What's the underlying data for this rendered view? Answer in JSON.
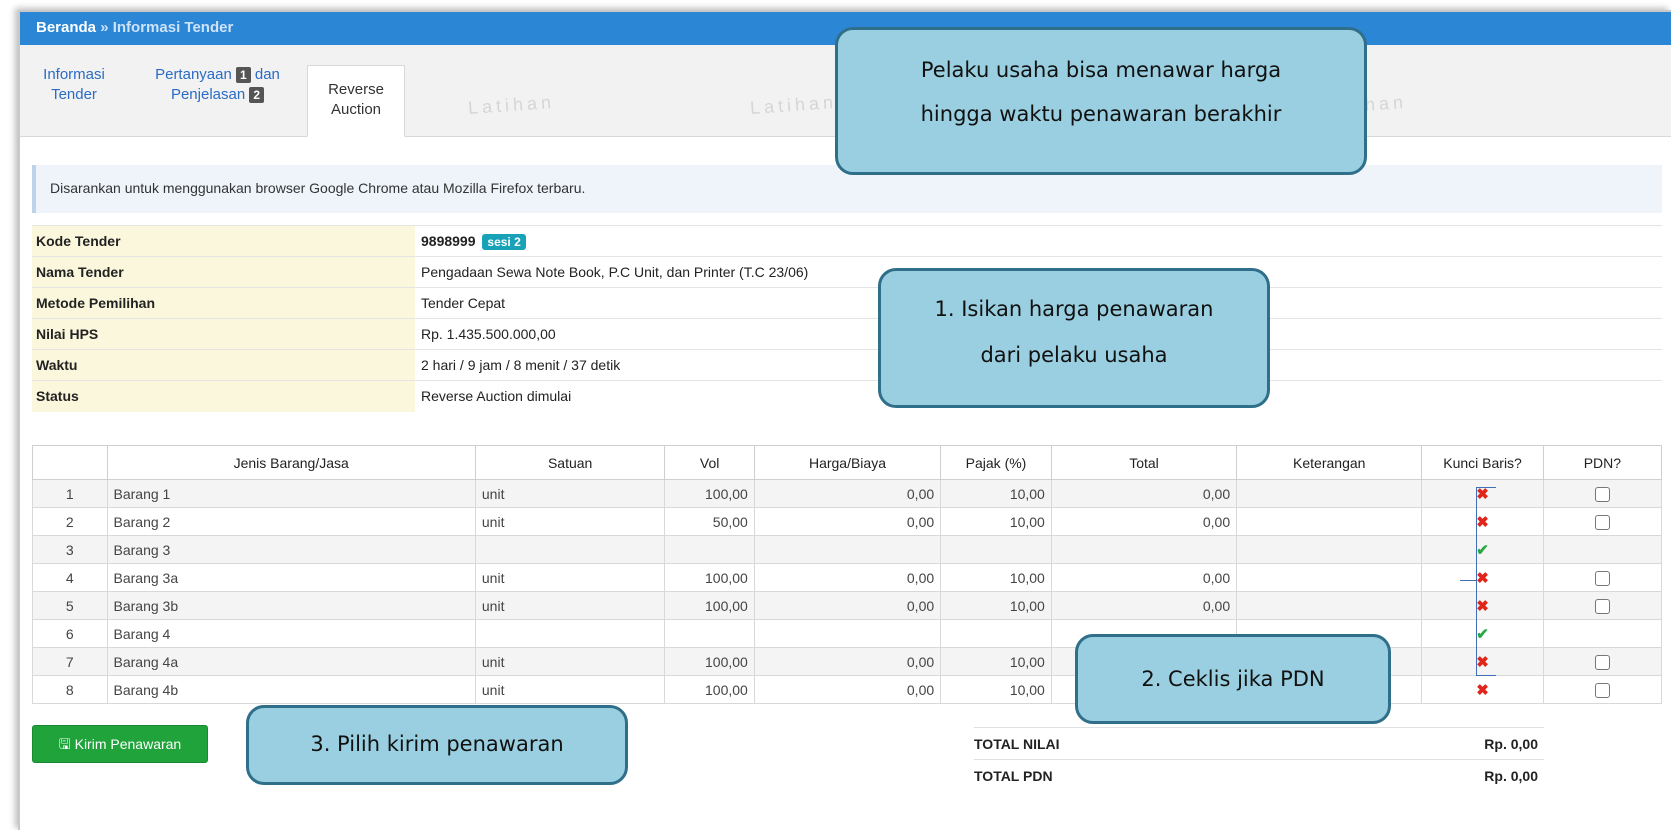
{
  "breadcrumb": {
    "home": "Beranda",
    "separator": "»",
    "current": "Informasi Tender"
  },
  "tabs": [
    {
      "line1": "Informasi",
      "line2": "Tender"
    },
    {
      "line1": "Pertanyaan",
      "badge1": "1",
      "line1b": "dan",
      "line2": "Penjelasan",
      "badge2": "2"
    },
    {
      "line1": "Reverse",
      "line2": "Auction"
    }
  ],
  "watermark": "Latihan",
  "notice": "Disarankan untuk menggunakan browser Google Chrome atau Mozilla Firefox terbaru.",
  "info": {
    "kode_label": "Kode Tender",
    "kode_value": "9898999",
    "sesi": "sesi 2",
    "nama_label": "Nama Tender",
    "nama_value": "Pengadaan Sewa Note Book, P.C Unit, dan Printer (T.C 23/06)",
    "metode_label": "Metode Pemilihan",
    "metode_value": "Tender Cepat",
    "hps_label": "Nilai HPS",
    "hps_value": "Rp. 1.435.500.000,00",
    "waktu_label": "Waktu",
    "waktu_value": "2 hari / 9 jam / 8 menit / 37 detik",
    "status_label": "Status",
    "status_value": "Reverse Auction dimulai"
  },
  "table": {
    "headers": [
      "",
      "Jenis Barang/Jasa",
      "Satuan",
      "Vol",
      "Harga/Biaya",
      "Pajak (%)",
      "Total",
      "Keterangan",
      "Kunci Baris?",
      "PDN?"
    ],
    "rows": [
      {
        "no": "1",
        "jenis": "Barang 1",
        "satuan": "unit",
        "vol": "100,00",
        "harga": "0,00",
        "pajak": "10,00",
        "total": "0,00",
        "ket": "",
        "kunci": "x",
        "pdn": true
      },
      {
        "no": "2",
        "jenis": "Barang 2",
        "satuan": "unit",
        "vol": "50,00",
        "harga": "0,00",
        "pajak": "10,00",
        "total": "0,00",
        "ket": "",
        "kunci": "x",
        "pdn": true
      },
      {
        "no": "3",
        "jenis": "Barang 3",
        "satuan": "",
        "vol": "",
        "harga": "",
        "pajak": "",
        "total": "",
        "ket": "",
        "kunci": "check",
        "pdn": false
      },
      {
        "no": "4",
        "jenis": "Barang 3a",
        "satuan": "unit",
        "vol": "100,00",
        "harga": "0,00",
        "pajak": "10,00",
        "total": "0,00",
        "ket": "",
        "kunci": "x",
        "pdn": true
      },
      {
        "no": "5",
        "jenis": "Barang 3b",
        "satuan": "unit",
        "vol": "100,00",
        "harga": "0,00",
        "pajak": "10,00",
        "total": "0,00",
        "ket": "",
        "kunci": "x",
        "pdn": true
      },
      {
        "no": "6",
        "jenis": "Barang 4",
        "satuan": "",
        "vol": "",
        "harga": "",
        "pajak": "",
        "total": "",
        "ket": "",
        "kunci": "check",
        "pdn": false
      },
      {
        "no": "7",
        "jenis": "Barang 4a",
        "satuan": "unit",
        "vol": "100,00",
        "harga": "0,00",
        "pajak": "10,00",
        "total": "",
        "ket": "",
        "kunci": "x",
        "pdn": true
      },
      {
        "no": "8",
        "jenis": "Barang 4b",
        "satuan": "unit",
        "vol": "100,00",
        "harga": "0,00",
        "pajak": "10,00",
        "total": "",
        "ket": "",
        "kunci": "x",
        "pdn": true
      }
    ]
  },
  "send_button": {
    "icon": "save-icon",
    "label": "Kirim Penawaran"
  },
  "totals": {
    "nilai_label": "TOTAL NILAI",
    "nilai_value": "Rp. 0,00",
    "pdn_label": "TOTAL PDN",
    "pdn_value": "Rp. 0,00"
  },
  "callouts": {
    "top_line1": "Pelaku usaha bisa menawar harga",
    "top_line2": "hingga waktu penawaran berakhir",
    "step1_line1": "1. Isikan harga penawaran",
    "step1_line2": "dari pelaku usaha",
    "step2": "2. Ceklis jika PDN",
    "step3": "3. Pilih kirim penawaran"
  },
  "colors": {
    "topbar": "#2b86d6",
    "callout_fill": "#99cfe0",
    "callout_border": "#2f6f8a",
    "button": "#1fa33a",
    "info_key_bg": "#fbf7dd"
  }
}
